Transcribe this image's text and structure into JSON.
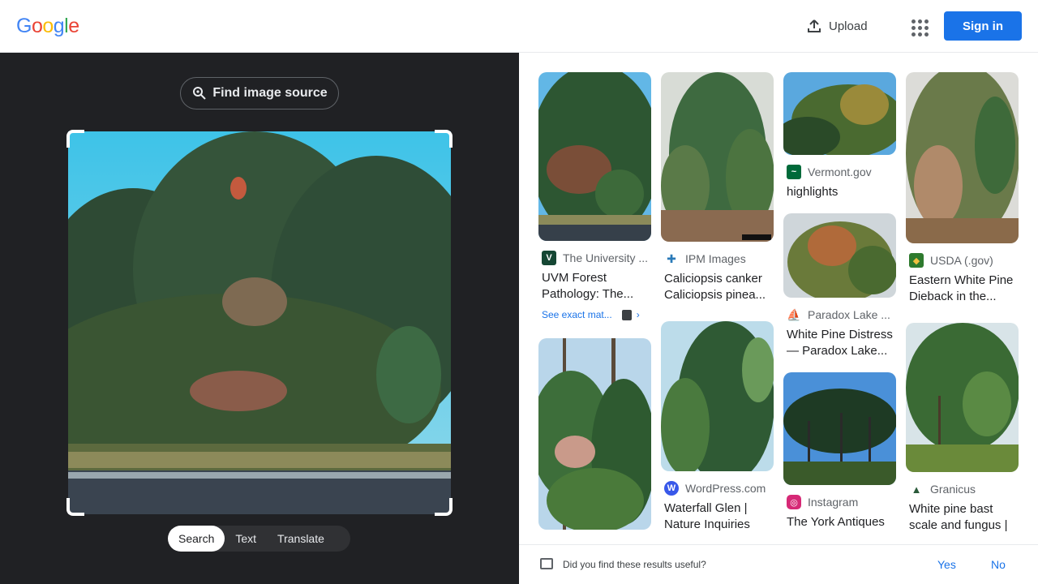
{
  "header": {
    "logo_text": "Google",
    "upload_label": "Upload",
    "signin_label": "Sign in",
    "colors": {
      "accent": "#1a73e8"
    }
  },
  "lens": {
    "find_source_label": "Find image source",
    "modes": [
      {
        "label": "Search",
        "active": true
      },
      {
        "label": "Text",
        "active": false
      },
      {
        "label": "Translate",
        "active": false
      }
    ]
  },
  "results": {
    "columns": [
      [
        {
          "source": "The University ...",
          "title": "UVM Forest Pathology: The...",
          "exact_match": "See exact mat...",
          "favicon": "uvm-shield-icon"
        },
        {
          "source": "",
          "title": "",
          "favicon": ""
        }
      ],
      [
        {
          "source": "IPM Images",
          "title": "Caliciopsis canker Caliciopsis pinea...",
          "favicon": "ipm-images-icon"
        },
        {
          "source": "WordPress.com",
          "title": "Waterfall Glen | Nature Inquiries",
          "favicon": "wordpress-icon"
        }
      ],
      [
        {
          "source": "Vermont.gov",
          "title": "highlights",
          "favicon": "vermont-gov-icon"
        },
        {
          "source": "Paradox Lake ...",
          "title": "White Pine Distress — Paradox Lake...",
          "favicon": "paradox-lake-icon"
        },
        {
          "source": "Instagram",
          "title": "The York Antiques",
          "favicon": "instagram-icon"
        }
      ],
      [
        {
          "source": "USDA (.gov)",
          "title": "Eastern White Pine Dieback in the...",
          "favicon": "usda-icon"
        },
        {
          "source": "Granicus",
          "title": "White pine bast scale and fungus |",
          "favicon": "granicus-icon"
        }
      ]
    ]
  },
  "feedback": {
    "question": "Did you find these results useful?",
    "yes": "Yes",
    "no": "No"
  }
}
